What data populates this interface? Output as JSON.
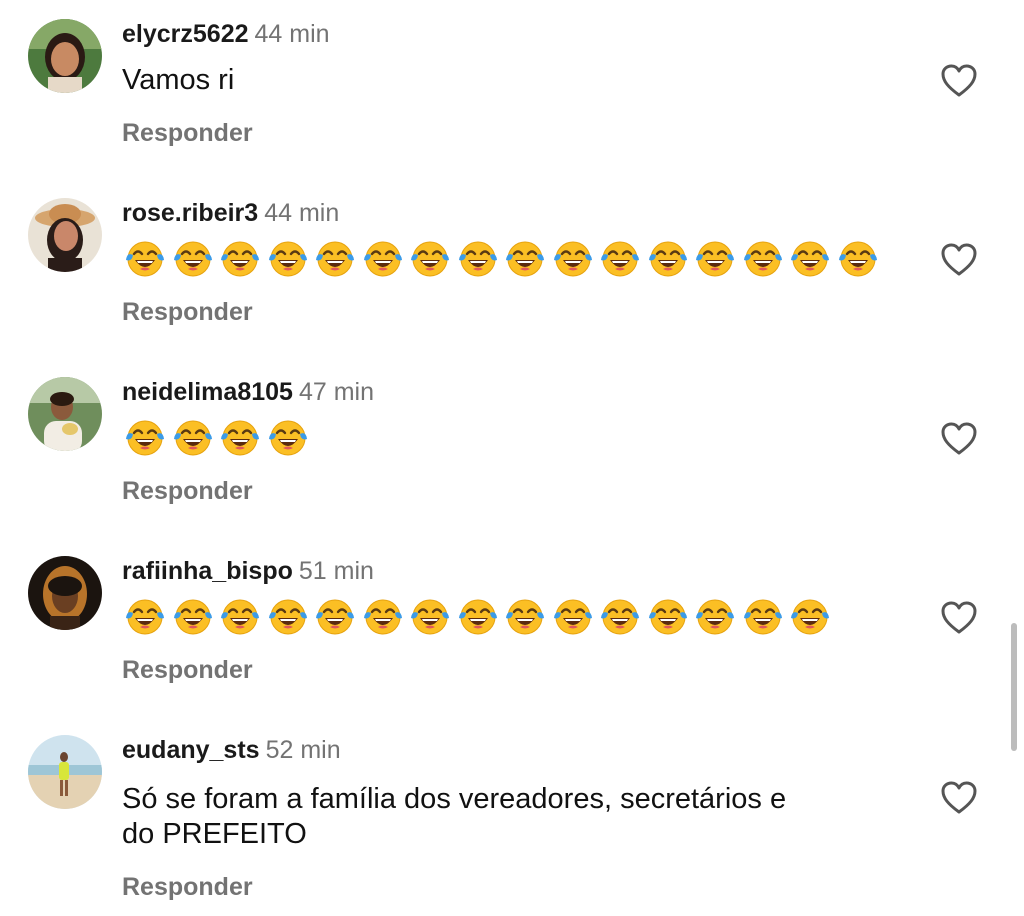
{
  "comments": [
    {
      "username": "elycrz5622",
      "time": "44 min",
      "text": "Vamos ri",
      "emoji_count": 0,
      "reply_label": "Responder"
    },
    {
      "username": "rose.ribeir3",
      "time": "44 min",
      "text": "",
      "emoji": "face-with-tears-of-joy",
      "emoji_count": 16,
      "reply_label": "Responder"
    },
    {
      "username": "neidelima8105",
      "time": "47 min",
      "text": "",
      "emoji": "face-with-tears-of-joy",
      "emoji_count": 4,
      "reply_label": "Responder"
    },
    {
      "username": "rafiinha_bispo",
      "time": "51 min",
      "text": "",
      "emoji": "face-with-tears-of-joy",
      "emoji_count": 15,
      "reply_label": "Responder"
    },
    {
      "username": "eudany_sts",
      "time": "52 min",
      "text_line1": "Só se foram a família dos vereadores, secretários e",
      "text_line2": "do PREFEITO",
      "emoji_count": 0,
      "reply_label": "Responder"
    }
  ],
  "icons": {
    "like": "heart-outline-icon",
    "emoji": "face-with-tears-of-joy"
  },
  "colors": {
    "username": "#1a1a1a",
    "secondary_text": "#737373",
    "icon_stroke": "#555555",
    "emoji_yellow": "#fbbf24",
    "tear_blue": "#3b9be8"
  }
}
